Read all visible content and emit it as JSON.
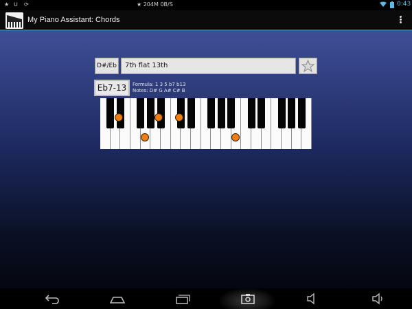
{
  "status_bar": {
    "network": "204M",
    "speed": "0B/S",
    "time": "0:43"
  },
  "app_bar": {
    "title": "My Piano Assistant: Chords"
  },
  "chord_selector": {
    "root_label": "D#/Eb",
    "chord_type_value": "7th flat 13th",
    "chord_symbol": "Eb7-13",
    "formula": "Formula: 1 3 5 b7 b13",
    "notes": "Notes: D# G A# C# B"
  },
  "keyboard": {
    "white_key_count": 21,
    "highlighted_notes": [
      "D#",
      "G",
      "A#",
      "C#",
      "B"
    ]
  },
  "colors": {
    "accent": "#2d6fb0",
    "note_marker": "#f07e14",
    "background_top": "#3e4f97",
    "background_bottom": "#04070f"
  }
}
